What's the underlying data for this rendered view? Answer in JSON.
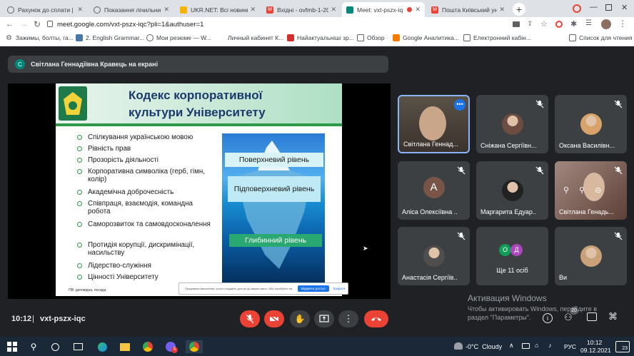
{
  "browser": {
    "tabs": [
      {
        "title": "Рахунок до сплати | ",
        "fav_color": "#5f6368"
      },
      {
        "title": "Показання лічильни",
        "fav_color": "#5f6368"
      },
      {
        "title": "UKR.NET: Всі новини",
        "fav_color": "#f4b400"
      },
      {
        "title": "Вхідні - ovfmb-1-20-",
        "fav_color": "#ea4335"
      },
      {
        "title": "Meet: vxt-pszx-iq",
        "fav_color": "#00897b",
        "active": true
      },
      {
        "title": "Пошта Київський унг",
        "fav_color": "#ea4335"
      }
    ],
    "url": "meet.google.com/vxt-pszx-iqc?pli=1&authuser=1",
    "bookmarks": [
      {
        "label": "Зажимы, болты, га...",
        "color": "#5f6368"
      },
      {
        "label": "2. English Grammar...",
        "color": "#4a76a8"
      },
      {
        "label": "Мои резюме — W...",
        "color": "#5f6368"
      },
      {
        "label": "Личный кабинет К...",
        "color": "#ffffff"
      },
      {
        "label": "Найактуальніші зр...",
        "color": "#d32f2f"
      },
      {
        "label": "Обзор",
        "color": "#5f6368"
      },
      {
        "label": "Google Аналитика...",
        "color": "#f57c00"
      },
      {
        "label": "Електронний кабін...",
        "color": "#5f6368"
      },
      {
        "label": "Список для чтения",
        "color": "#5f6368"
      }
    ]
  },
  "meet": {
    "presenter_initial": "С",
    "presenting_text": "Світлана Геннадіївна Кравець на екрані",
    "time": "10:12",
    "meeting_code": "vxt-pszx-iqc",
    "participant_count": "20",
    "participants": [
      {
        "name": "Світлана Геннад...",
        "kind": "video",
        "active": true
      },
      {
        "name": "Сніжана Сергіївн...",
        "kind": "photo",
        "color": "#6d4c41"
      },
      {
        "name": "Оксана Василівн...",
        "kind": "photo",
        "color": "#d7a36a"
      },
      {
        "name": "Аліса Олексіївна ...",
        "kind": "letter",
        "letter": "А",
        "color": "#795548"
      },
      {
        "name": "Маргарита Едуар...",
        "kind": "photo",
        "color": "#222222"
      },
      {
        "name": "Світлана Генадь...",
        "kind": "video2",
        "color": "#8d6e63"
      },
      {
        "name": "Анастасія Сергіїв...",
        "kind": "photo",
        "color": "#4e4e4e"
      },
      {
        "name": "Ще 11 осіб",
        "kind": "group",
        "letters": [
          "О",
          "Д"
        ]
      },
      {
        "name": "Ви",
        "kind": "photo",
        "color": "#c9a27a"
      }
    ]
  },
  "slide": {
    "title_line1": "Кодекс корпоративної",
    "title_line2": "культури Університету",
    "bullets": [
      "Спілкування українською мовою",
      "Рівність прав",
      "Прозорість діяльності",
      "Корпоративна символіка (герб, гімн, колір)",
      "Академічна доброчесність",
      "Співпраця, взаємодія, командна робота",
      "Саморозвиток та самовдосконалення",
      "Протидія корупції, дискримінації, насильству",
      "Лідерство-служіння",
      "Цінності Університету"
    ],
    "iceberg": {
      "level1": "Поверхневий рівень",
      "level2": "Підповерхневий рівень",
      "level3": "Глибинний рівень"
    },
    "footer_text": "ПВ: доповідна, посада",
    "popup_text": "Продовжте виконання, просто надайте доступ до ваших вікон. Або спробуйте екран",
    "popup_button": "Відкрити доступ",
    "popup_dismiss": "Закрити"
  },
  "windows": {
    "activation_title": "Активация Windows",
    "activation_text1": "Чтобы активировать Windows, перейдите в",
    "activation_text2": "раздел \"Параметры\".",
    "weather": "-0°C  Cloudy",
    "lang": "РУС",
    "clock_time": "10:12",
    "clock_date": "09.12.2021",
    "notif_count": "23"
  },
  "colors": {
    "meet_bg": "#202124",
    "accent_blue": "#8ab4f8",
    "end_call_red": "#ea4335",
    "slide_title_blue": "#1a3a6b",
    "bullet_green": "#2e9a48"
  }
}
